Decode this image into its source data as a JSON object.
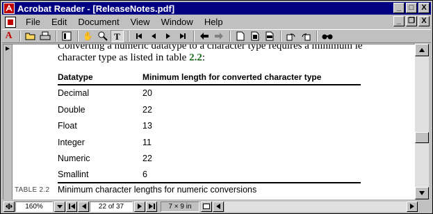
{
  "window": {
    "title": "Acrobat Reader - [ReleaseNotes.pdf]",
    "controls": {
      "minimize": "_",
      "maximize": "□",
      "close": "X"
    }
  },
  "menubar": {
    "items": [
      "File",
      "Edit",
      "Document",
      "View",
      "Window",
      "Help"
    ],
    "doc_controls": {
      "minimize": "_",
      "restore": "❐",
      "close": "X"
    }
  },
  "toolbar": {
    "tools": [
      "adobe-logo",
      "open-icon",
      "print-icon",
      "thumbnails-icon",
      "hand-tool-icon",
      "zoom-tool-icon",
      "text-select-icon",
      "first-page-icon",
      "prev-page-icon",
      "next-page-icon",
      "last-page-icon",
      "go-back-icon",
      "go-forward-icon",
      "actual-size-icon",
      "fit-page-icon",
      "fit-width-icon",
      "rotate-left-icon",
      "rotate-right-icon",
      "find-icon"
    ],
    "text_tool_label": "T"
  },
  "document": {
    "para_line1": "Converting a numeric datatype to a character type requires a minimum le",
    "para_line2_prefix": "character type as listed in table ",
    "para_line2_ref": "2.2",
    "para_line2_suffix": ":",
    "table": {
      "headers": [
        "Datatype",
        "Minimum length for converted character type"
      ],
      "rows": [
        [
          "Decimal",
          "20"
        ],
        [
          "Double",
          "22"
        ],
        [
          "Float",
          "13"
        ],
        [
          "Integer",
          "11"
        ],
        [
          "Numeric",
          "22"
        ],
        [
          "Smallint",
          "6"
        ]
      ],
      "caption_label": "TABLE 2.2",
      "caption_text": "Minimum character lengths for numeric conversions"
    }
  },
  "statusbar": {
    "zoom": "160%",
    "page": "22 of 37",
    "page_size": "7 × 9 in"
  },
  "colors": {
    "titlebar": "#000080",
    "table_ref": "#1a6b1a",
    "adobe_red": "#c00000"
  }
}
